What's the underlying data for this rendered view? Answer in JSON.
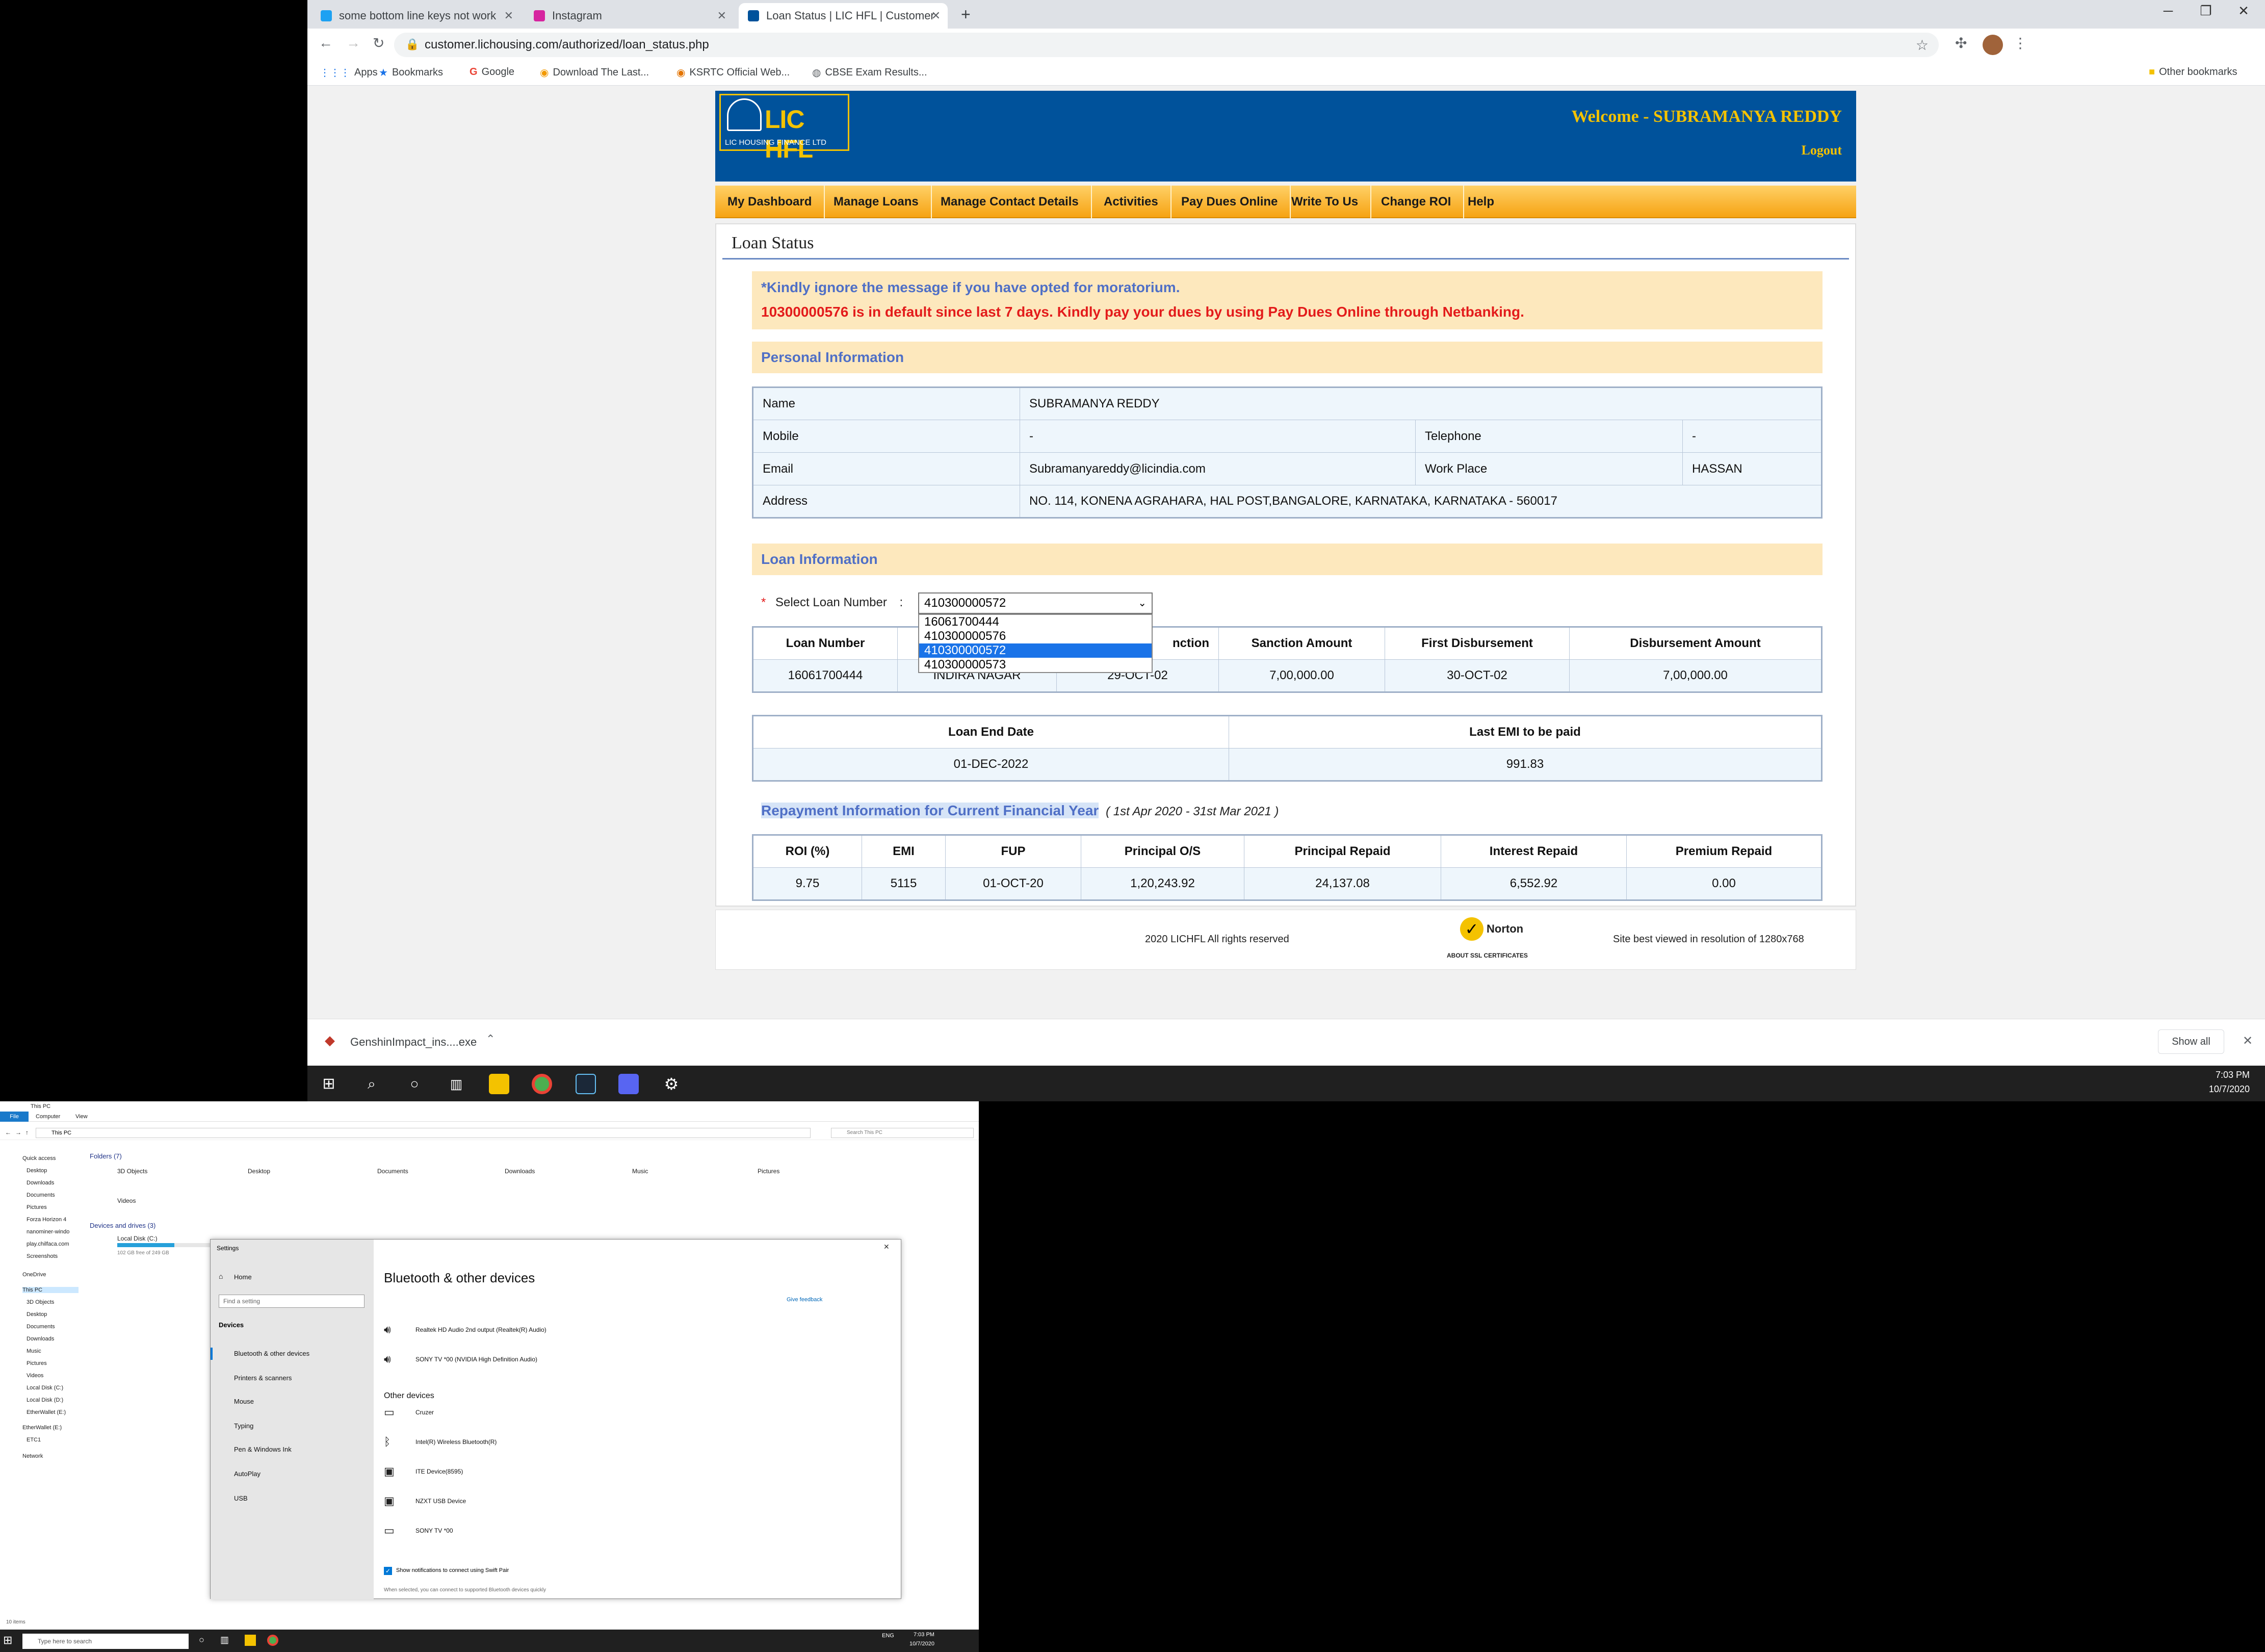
{
  "browser": {
    "tabs": [
      {
        "title": "some bottom line keys not work",
        "color": "#1da1f2"
      },
      {
        "title": "Instagram",
        "color": "#d6249f"
      },
      {
        "title": "Loan Status | LIC HFL | Customer",
        "color": "#00529b"
      }
    ],
    "new_tab": "+",
    "address": "customer.lichousing.com/authorized/loan_status.php",
    "bookmarks": [
      "Apps",
      "Bookmarks",
      "Google",
      "Download The Last...",
      "KSRTC Official Web...",
      "CBSE Exam Results..."
    ],
    "other_bookmarks": "Other bookmarks"
  },
  "site": {
    "logo_text": "LIC HFL",
    "logo_sub": "LIC HOUSING FINANCE LTD",
    "welcome": "Welcome - SUBRAMANYA REDDY",
    "logout": "Logout",
    "menu": [
      "My Dashboard",
      "Manage Loans",
      "Manage Contact Details",
      "Activities",
      "Pay Dues Online",
      "Write To Us",
      "Change ROI",
      "Help"
    ],
    "page_title": "Loan Status",
    "alert_info": "*Kindly ignore the message if you have opted for moratorium.",
    "alert_default": "10300000576 is in default since last 7 days. Kindly pay your dues by using Pay Dues Online through Netbanking.",
    "personal_heading": "Personal Information",
    "personal": {
      "name_label": "Name",
      "name": "SUBRAMANYA REDDY",
      "mobile_label": "Mobile",
      "mobile": "-",
      "telephone_label": "Telephone",
      "telephone": "-",
      "email_label": "Email",
      "email": "Subramanyareddy@licindia.com",
      "workplace_label": "Work Place",
      "workplace": "HASSAN",
      "address_label": "Address",
      "address": "NO. 114, KONENA AGRAHARA, HAL POST,BANGALORE, KARNATAKA, KARNATAKA - 560017"
    },
    "loan_heading": "Loan Information",
    "select_label": "Select Loan Number",
    "select_required": "*",
    "select_colon": ":",
    "select_value": "410300000572",
    "select_options": [
      "16061700444",
      "410300000576",
      "410300000572",
      "410300000573"
    ],
    "loan_table": {
      "headers": [
        "Loan Number",
        "",
        "nction",
        "Sanction Amount",
        "First Disbursement",
        "Disbursement Amount"
      ],
      "row": [
        "16061700444",
        "INDIRA NAGAR",
        "29-OCT-02",
        "7,00,000.00",
        "30-OCT-02",
        "7,00,000.00"
      ]
    },
    "end_table": {
      "headers": [
        "Loan End Date",
        "Last EMI to be paid"
      ],
      "row": [
        "01-DEC-2022",
        "991.83"
      ]
    },
    "repay_heading": "Repayment Information for Current Financial Year",
    "repay_period": "( 1st Apr 2020 - 31st Mar 2021 )",
    "repay_table": {
      "headers": [
        "ROI (%)",
        "EMI",
        "FUP",
        "Principal O/S",
        "Principal Repaid",
        "Interest Repaid",
        "Premium Repaid"
      ],
      "row": [
        "9.75",
        "5115",
        "01-OCT-20",
        "1,20,243.92",
        "24,137.08",
        "6,552.92",
        "0.00"
      ]
    },
    "footer_copy": "2020 LICHFL All rights reserved",
    "norton": "Norton",
    "norton_sub": "ABOUT SSL CERTIFICATES",
    "footer_res": "Site best viewed in resolution of 1280x768"
  },
  "download": {
    "file": "GenshinImpact_ins....exe",
    "show_all": "Show all"
  },
  "taskbar": {
    "time": "7:03 PM",
    "date": "10/7/2020"
  },
  "explorer": {
    "title": "This PC",
    "ribbon": [
      "File",
      "Computer",
      "View"
    ],
    "path": "This PC",
    "search": "Search This PC",
    "folders_heading": "Folders (7)",
    "folders": [
      "3D Objects",
      "Desktop",
      "Documents",
      "Downloads",
      "Music",
      "Pictures",
      "Videos"
    ],
    "drives_heading": "Devices and drives (3)",
    "drive_c": "Local Disk (C:)",
    "drive_c_free": "102 GB free of 249 GB",
    "nav": [
      "Quick access",
      "Desktop",
      "Downloads",
      "Documents",
      "Pictures",
      "Forza Horizon 4",
      "nanominer-windo",
      "play.chilfaca.com",
      "Screenshots",
      "OneDrive",
      "This PC",
      "3D Objects",
      "Desktop",
      "Documents",
      "Downloads",
      "Music",
      "Pictures",
      "Videos",
      "Local Disk (C:)",
      "Local Disk (D:)",
      "EtherWallet (E:)",
      "EtherWallet (E:)",
      "ETC1",
      "Network"
    ],
    "status": "10 items"
  },
  "settings": {
    "title": "Settings",
    "home": "Home",
    "search": "Find a setting",
    "section": "Devices",
    "nav": [
      "Bluetooth & other devices",
      "Printers & scanners",
      "Mouse",
      "Typing",
      "Pen & Windows Ink",
      "AutoPlay",
      "USB"
    ],
    "heading": "Bluetooth & other devices",
    "feedback": "Give feedback",
    "audio": [
      "Realtek HD Audio 2nd output (Realtek(R) Audio)",
      "SONY TV *00 (NVIDIA High Definition Audio)"
    ],
    "other_heading": "Other devices",
    "other": [
      "Cruzer",
      "Intel(R) Wireless Bluetooth(R)",
      "ITE Device(8595)",
      "NZXT USB Device",
      "SONY TV *00"
    ],
    "swift_pair": "Show notifications to connect using Swift Pair",
    "swift_note": "When selected, you can connect to supported Bluetooth devices quickly"
  },
  "taskbar2": {
    "search": "Type here to search",
    "lang": "ENG",
    "time": "7:03 PM",
    "date": "10/7/2020"
  }
}
